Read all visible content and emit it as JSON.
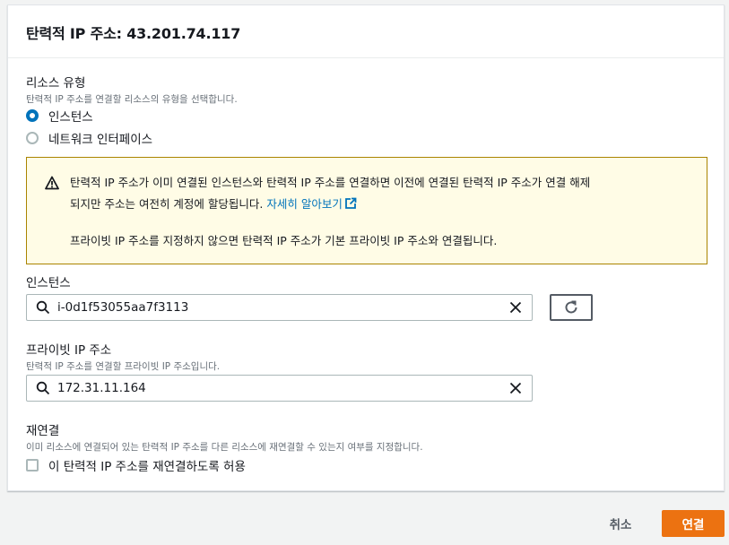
{
  "dialog": {
    "title": "탄력적 IP 주소: 43.201.74.117"
  },
  "resource_type": {
    "label": "리소스 유형",
    "description": "탄력적 IP 주소를 연결할 리소스의 유형을 선택합니다.",
    "options": [
      {
        "label": "인스턴스",
        "checked": true
      },
      {
        "label": "네트워크 인터페이스",
        "checked": false
      }
    ]
  },
  "alert": {
    "text1": "탄력적 IP 주소가 이미 연결된 인스턴스와 탄력적 IP 주소를 연결하면 이전에 연결된 탄력적 IP 주소가 연결 해제",
    "text2": "되지만 주소는 여전히 계정에 할당됩니다.",
    "link": "자세히 알아보기",
    "text3": "프라이빗 IP 주소를 지정하지 않으면 탄력적 IP 주소가 기본 프라이빗 IP 주소와 연결됩니다.",
    "color_bg": "#fffce6",
    "color_border": "#aa8400"
  },
  "instance": {
    "label": "인스턴스",
    "value": "i-0d1f53055aa7f3113"
  },
  "private_ip": {
    "label": "프라이빗 IP 주소",
    "description": "탄력적 IP 주소를 연결할 프라이빗 IP 주소입니다.",
    "value": "172.31.11.164"
  },
  "reassociate": {
    "label": "재연결",
    "description": "이미 리소스에 연결되어 있는 탄력적 IP 주소를 다른 리소스에 재연결할 수 있는지 여부를 지정합니다.",
    "checkbox_label": "이 탄력적 IP 주소를 재연결하도록 허용",
    "checked": false
  },
  "footer": {
    "cancel_label": "취소",
    "confirm_label": "연결"
  },
  "colors": {
    "accent": "#0073bb",
    "primary_button": "#ec7211"
  },
  "icons": [
    "warning-icon",
    "external-link-icon",
    "search-icon",
    "clear-icon",
    "refresh-icon"
  ]
}
